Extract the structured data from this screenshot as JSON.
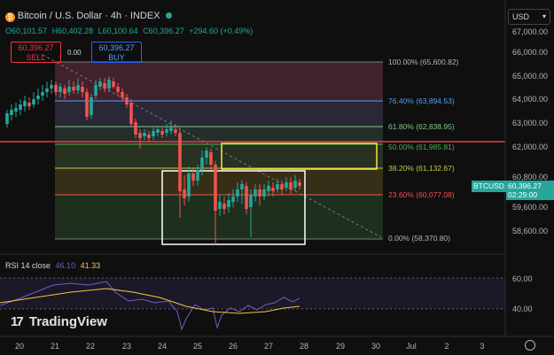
{
  "header": {
    "title": "Bitcoin / U.S. Dollar · 4h · INDEX",
    "ohlc": {
      "o": "O60,101.57",
      "h": "H60,402.28",
      "l": "L60,100.64",
      "c": "C60,396.27",
      "change": "+294.60 (+0.49%)"
    },
    "currency": "USD"
  },
  "trade": {
    "sell_price": "60,396.27",
    "sell_label": "SELL",
    "spread": "0.00",
    "buy_price": "60,396.27",
    "buy_label": "BUY"
  },
  "price_axis": [
    "67,000.00",
    "66,000.00",
    "65,000.00",
    "64,000.00",
    "63,000.00",
    "62,000.00",
    "60,800.00",
    "59,600.00",
    "58,600.00"
  ],
  "symbol_tag": {
    "symbol": "BTCUSD",
    "price": "60,396.27",
    "countdown": "02:29:00"
  },
  "fib": [
    {
      "label": "100.00% (65,600.82)",
      "color": "#b2b5be"
    },
    {
      "label": "76.40% (63,894.53)",
      "color": "#5b9cf6"
    },
    {
      "label": "61.80% (62,838.95)",
      "color": "#81c784"
    },
    {
      "label": "50.00% (61,985.81)",
      "color": "#4caf50"
    },
    {
      "label": "38.20% (61,132.67)",
      "color": "#c8c84a"
    },
    {
      "label": "23.60% (60,077.08)",
      "color": "#ef5350"
    },
    {
      "label": "0.00% (58,370.80)",
      "color": "#b2b5be"
    }
  ],
  "rsi": {
    "title": "RSI 14 close",
    "value1": "46.10",
    "value2": "41.33",
    "axis": [
      "60.00",
      "40.00"
    ]
  },
  "x_axis": [
    "20",
    "21",
    "22",
    "23",
    "24",
    "25",
    "26",
    "27",
    "28",
    "29",
    "30",
    "Jul",
    "2",
    "3"
  ],
  "watermark": "TradingView",
  "colors": {
    "up": "#26a69a",
    "down": "#ef5350",
    "rsi_line": "#7e57c2",
    "rsi_ma": "#f5c542",
    "redline": "#f23645"
  }
}
